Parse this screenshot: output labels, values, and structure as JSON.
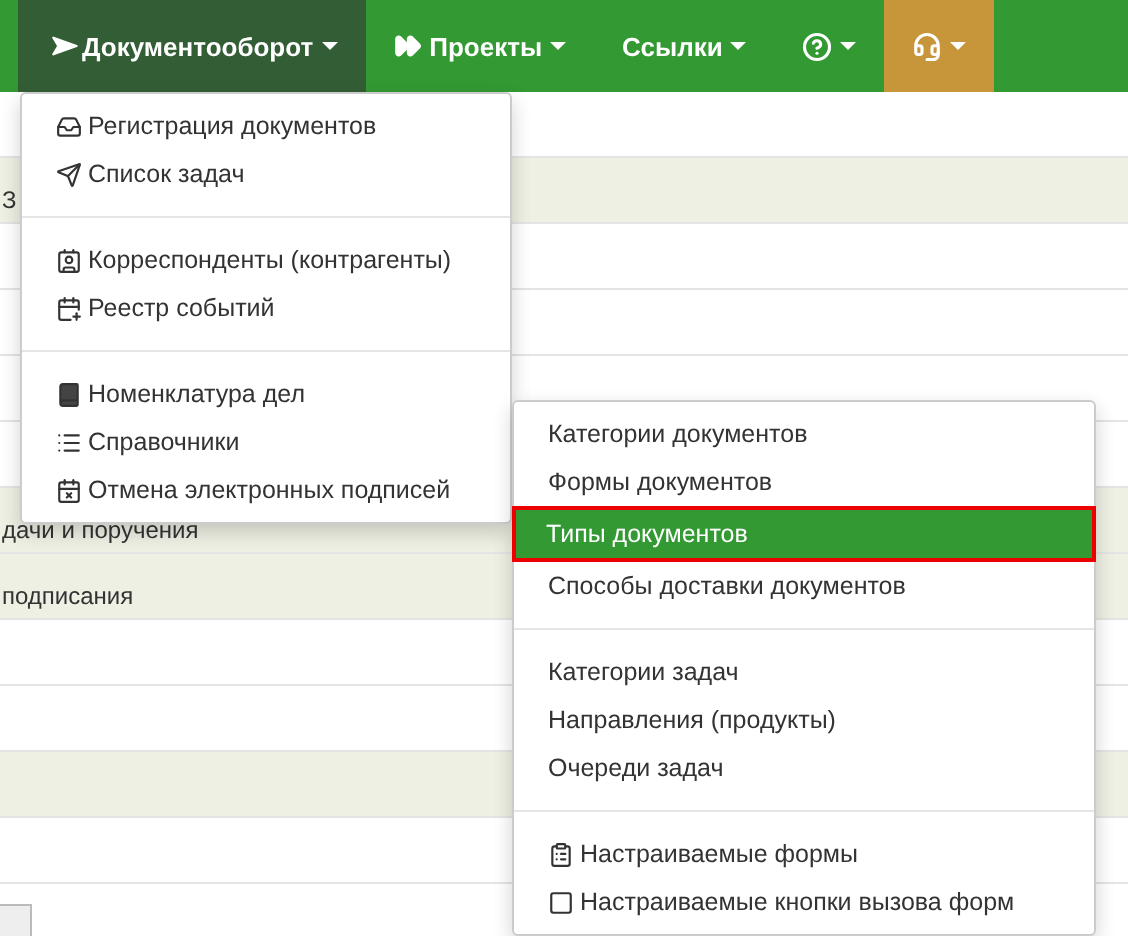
{
  "navbar": {
    "items": [
      {
        "label": "Документооборот",
        "selected": true,
        "kind": "normal"
      },
      {
        "label": "Проекты",
        "selected": false,
        "kind": "normal"
      },
      {
        "label": "Ссылки",
        "selected": false,
        "kind": "normal"
      },
      {
        "selected": false,
        "kind": "normal"
      },
      {
        "selected": false,
        "kind": "accent"
      }
    ]
  },
  "background_rows": [
    {
      "shaded": false
    },
    {
      "text": "З",
      "shaded": true
    },
    {
      "shaded": false
    },
    {
      "shaded": false
    },
    {
      "shaded": false
    },
    {
      "shaded": false
    },
    {
      "text": "дачи и поручения",
      "shaded": true
    },
    {
      "text": "подписания",
      "shaded": true
    },
    {
      "shaded": false
    },
    {
      "shaded": false
    },
    {
      "shaded": true
    },
    {
      "shaded": false
    }
  ],
  "main_menu": {
    "groups": [
      [
        {
          "label": "Регистрация документов"
        },
        {
          "label": "Список задач"
        }
      ],
      [
        {
          "label": "Корреспонденты (контрагенты)"
        },
        {
          "label": "Реестр событий"
        }
      ],
      [
        {
          "label": "Номенклатура дел"
        },
        {
          "label": "Справочники"
        },
        {
          "label": "Отмена электронных подписей"
        }
      ]
    ]
  },
  "submenu": {
    "groups": [
      [
        {
          "label": "Категории документов",
          "selected": false
        },
        {
          "label": "Формы документов",
          "selected": false
        },
        {
          "label": "Типы документов",
          "selected": true
        },
        {
          "label": "Способы доставки документов",
          "selected": false
        }
      ],
      [
        {
          "label": "Категории задач",
          "selected": false
        },
        {
          "label": "Направления (продукты)",
          "selected": false
        },
        {
          "label": "Очереди задач",
          "selected": false
        }
      ],
      [
        {
          "label": "Настраиваемые формы",
          "selected": false
        },
        {
          "label": "Настраиваемые кнопки вызова форм",
          "selected": false
        }
      ]
    ]
  }
}
